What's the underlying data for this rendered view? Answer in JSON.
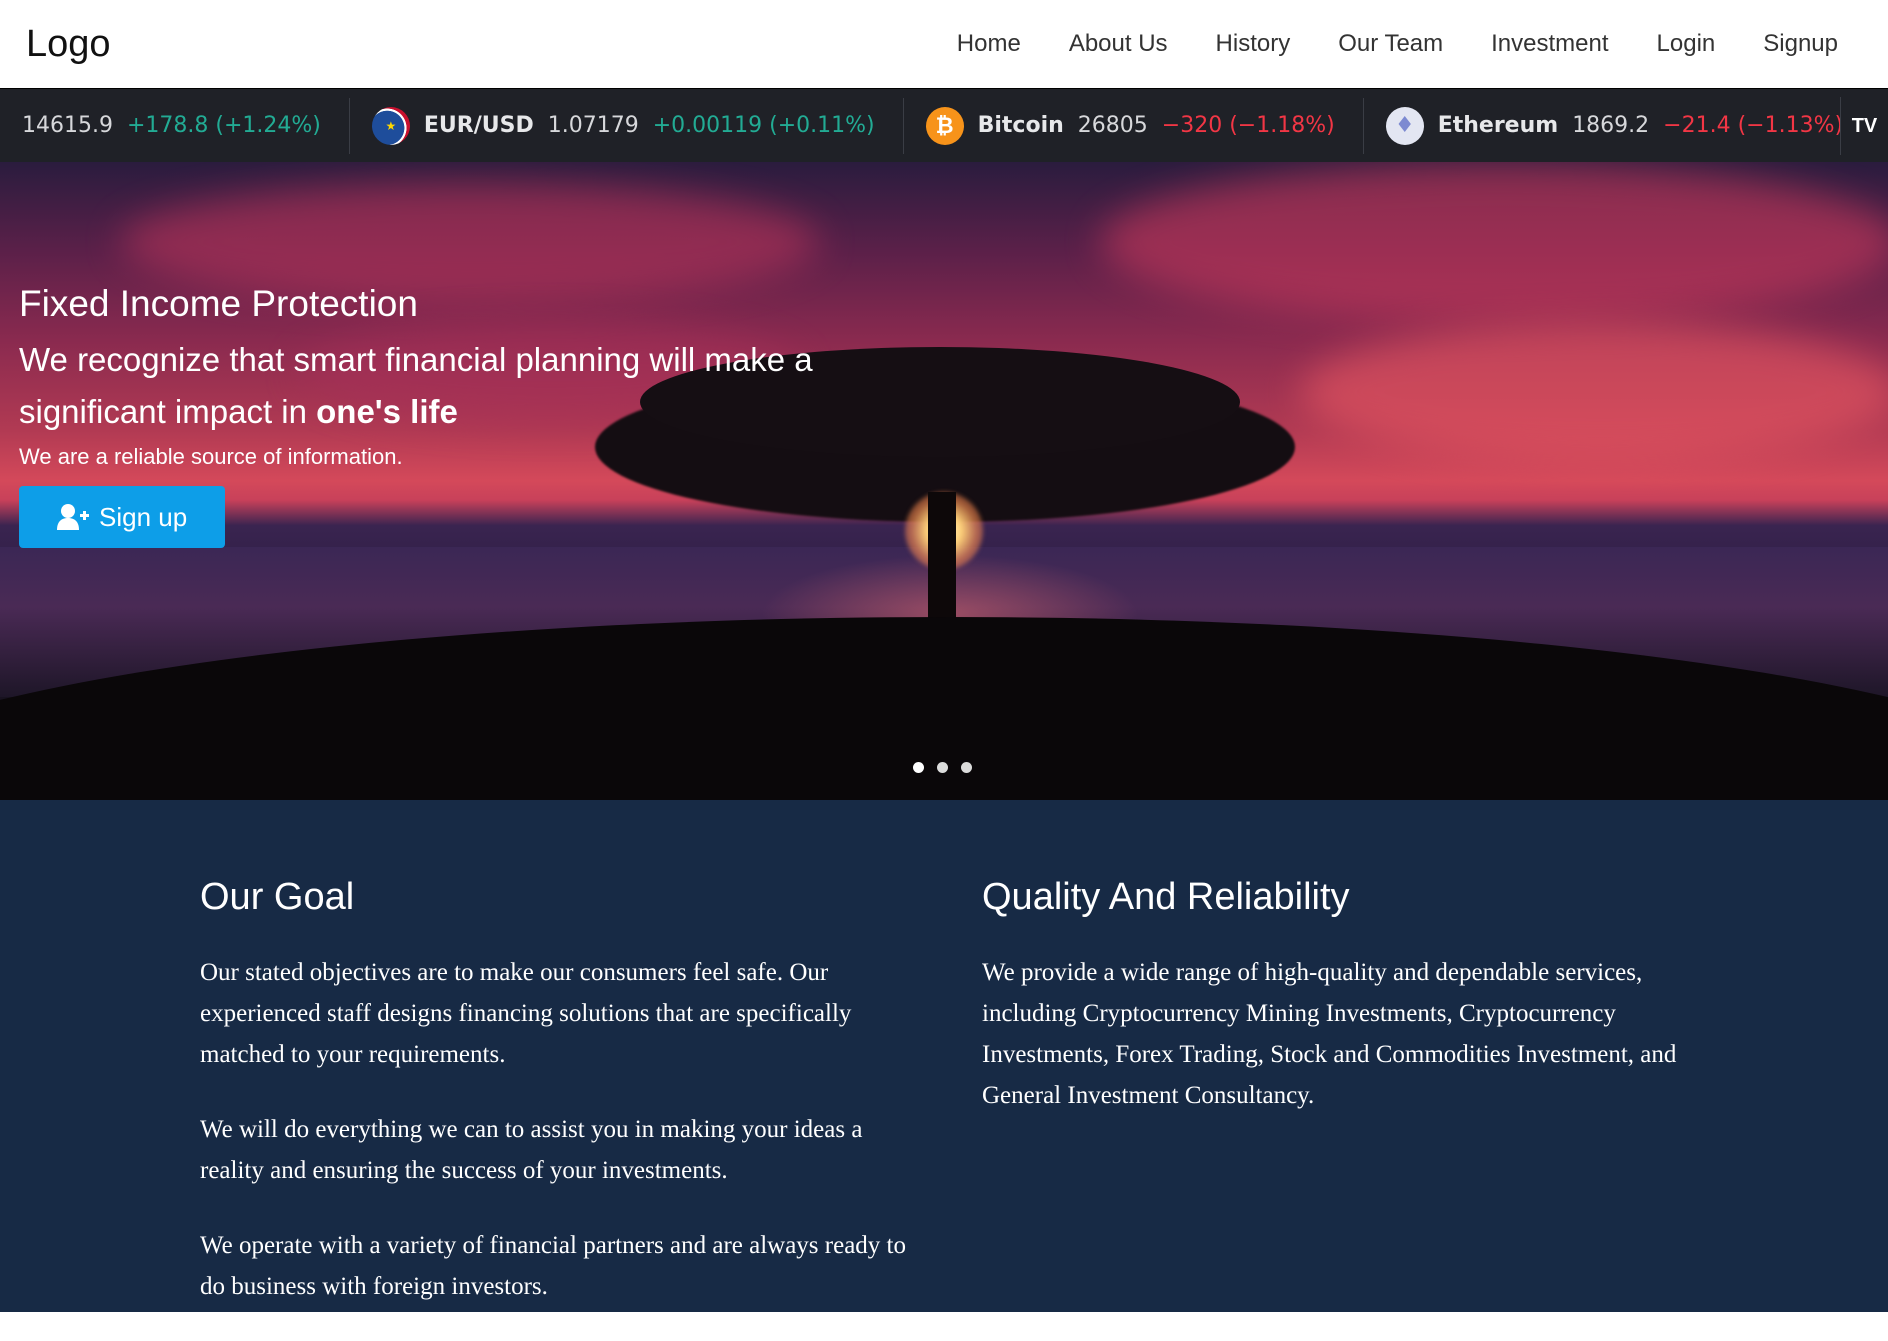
{
  "navbar": {
    "logo": "Logo",
    "links": [
      "Home",
      "About Us",
      "History",
      "Our Team",
      "Investment",
      "Login",
      "Signup"
    ]
  },
  "ticker": {
    "items": [
      {
        "symbol": "",
        "value": "14615.9",
        "change": "+178.8 (+1.24%)",
        "direction": "up",
        "icon": ""
      },
      {
        "symbol": "EUR/USD",
        "value": "1.07179",
        "change": "+0.00119 (+0.11%)",
        "direction": "up",
        "icon": "eur-usd-flag-icon"
      },
      {
        "symbol": "Bitcoin",
        "value": "26805",
        "change": "−320 (−1.18%)",
        "direction": "down",
        "icon": "bitcoin-icon"
      },
      {
        "symbol": "Ethereum",
        "value": "1869.2",
        "change": "−21.4 (−1.13%)",
        "direction": "down",
        "icon": "ethereum-icon"
      }
    ],
    "brand": "TV"
  },
  "hero": {
    "title": "Fixed Income Protection",
    "subtitle_main": "We recognize that smart financial planning will make a significant impact in ",
    "subtitle_bold": "one's life",
    "tagline": "We are a reliable source of information.",
    "button_label": "Sign up",
    "slides": 3,
    "active_slide": 0
  },
  "content": {
    "goal": {
      "heading": "Our Goal",
      "paragraphs": [
        "Our stated objectives are to make our consumers feel safe. Our experienced staff designs financing solutions that are specifically matched to your requirements.",
        "We will do everything we can to assist you in making your ideas a reality and ensuring the success of your investments.",
        "We operate with a variety of financial partners and are always ready to do business with foreign investors."
      ]
    },
    "quality": {
      "heading": "Quality And Reliability",
      "paragraphs": [
        "We provide a wide range of high-quality and dependable services, including Cryptocurrency Mining Investments, Cryptocurrency Investments, Forex Trading, Stock and Commodities Investment, and General Investment Consultancy."
      ]
    }
  },
  "colors": {
    "ticker_bg": "#1f2127",
    "up": "#22ab94",
    "down": "#f23645",
    "button": "#0d9ee8",
    "content_bg": "#172a45"
  }
}
